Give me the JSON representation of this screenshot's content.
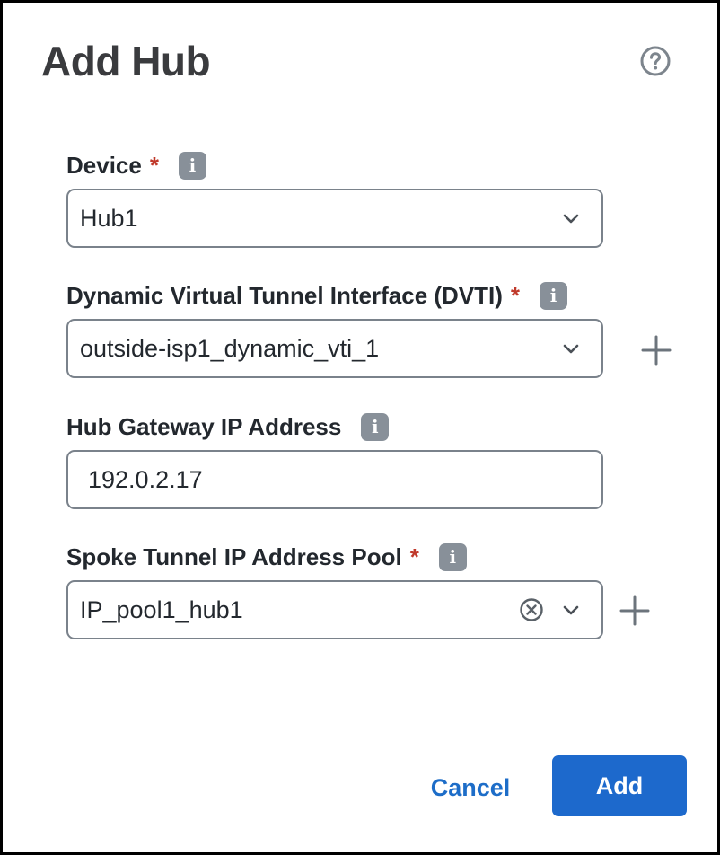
{
  "dialog": {
    "title": "Add Hub"
  },
  "fields": {
    "device": {
      "label": "Device",
      "required": "*",
      "value": "Hub1"
    },
    "dvti": {
      "label": "Dynamic Virtual Tunnel Interface (DVTI)",
      "required": "*",
      "value": "outside-isp1_dynamic_vti_1"
    },
    "gateway": {
      "label": "Hub Gateway IP Address",
      "value": "192.0.2.17"
    },
    "pool": {
      "label": "Spoke Tunnel IP Address Pool",
      "required": "*",
      "value": "IP_pool1_hub1"
    }
  },
  "icons": {
    "info": "i",
    "help": "help-circle-icon",
    "chevron": "chevron-down-icon",
    "plus": "plus-icon",
    "clear": "clear-circle-icon"
  },
  "footer": {
    "cancel_label": "Cancel",
    "add_label": "Add"
  },
  "colors": {
    "primary": "#1d69cc",
    "link": "#1d6dc8",
    "required": "#c0392b",
    "info_badge": "#889099",
    "border": "#7a828b"
  }
}
